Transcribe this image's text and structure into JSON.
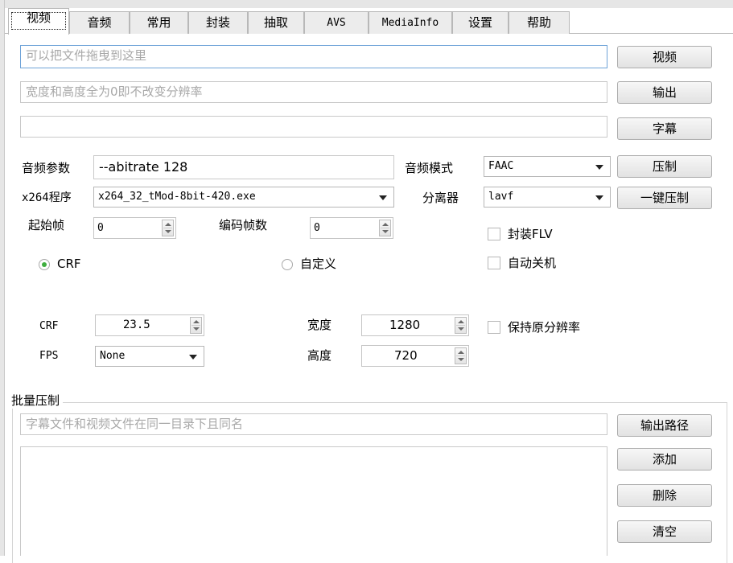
{
  "tabs": [
    {
      "label": "视频"
    },
    {
      "label": "音频"
    },
    {
      "label": "常用"
    },
    {
      "label": "封装"
    },
    {
      "label": "抽取"
    },
    {
      "label": "AVS"
    },
    {
      "label": "MediaInfo"
    },
    {
      "label": "设置"
    },
    {
      "label": "帮助"
    }
  ],
  "fields": {
    "video_file_placeholder": "可以把文件拖曳到这里",
    "resolution_placeholder": "宽度和高度全为0即不改变分辨率",
    "subtitle_value": ""
  },
  "buttons": {
    "video": "视频",
    "output": "输出",
    "subtitle": "字幕",
    "encode": "压制",
    "one_click": "一键压制",
    "output_path": "输出路径",
    "add": "添加",
    "delete": "删除",
    "clear": "清空"
  },
  "audio": {
    "params_label": "音频参数",
    "params_value": "--abitrate 128",
    "mode_label": "音频模式",
    "mode_value": "FAAC"
  },
  "x264": {
    "label": "x264程序",
    "value": "x264_32_tMod-8bit-420.exe",
    "demuxer_label": "分离器",
    "demuxer_value": "lavf"
  },
  "frames": {
    "start_label": "起始帧",
    "start_value": "0",
    "count_label": "编码帧数",
    "count_value": "0"
  },
  "options": {
    "flv_label": "封装FLV",
    "flv_checked": false,
    "shutdown_label": "自动关机",
    "shutdown_checked": false,
    "keep_res_label": "保持原分辨率",
    "keep_res_checked": false
  },
  "rate_mode": {
    "crf_label": "CRF",
    "custom_label": "自定义",
    "selected": "CRF"
  },
  "encode": {
    "crf_label": "CRF",
    "crf_value": "23.5",
    "fps_label": "FPS",
    "fps_value": "None",
    "width_label": "宽度",
    "width_value": "1280",
    "height_label": "高度",
    "height_value": "720"
  },
  "batch": {
    "title": "批量压制",
    "hint_placeholder": "字幕文件和视频文件在同一目录下且同名",
    "items": []
  },
  "colors": {
    "focus_border": "#6fa3d8",
    "radio_dot": "#3fae3f",
    "placeholder": "#a8a8a8"
  }
}
